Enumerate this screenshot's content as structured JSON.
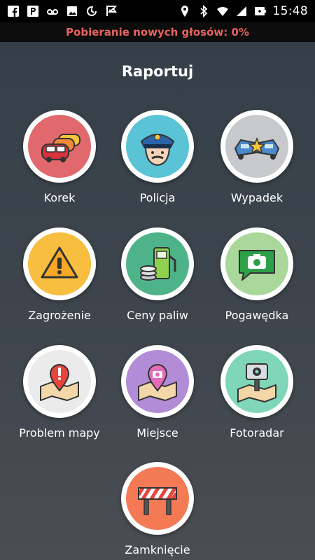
{
  "status_bar": {
    "time": "15:48",
    "left_icons": [
      "facebook-icon",
      "parking-icon",
      "voicemail-icon",
      "image-icon",
      "sync-icon",
      "check-flag-icon"
    ],
    "right_icons": [
      "location-icon",
      "bluetooth-icon",
      "wifi-icon",
      "signal-icon",
      "battery-icon"
    ]
  },
  "banner": {
    "text": "Pobieranie nowych głosów: 0%",
    "color": "#e8625f"
  },
  "title": "Raportuj",
  "tiles": [
    {
      "label": "Korek",
      "icon": "traffic-jam-icon",
      "color": "#e1696e"
    },
    {
      "label": "Policja",
      "icon": "police-icon",
      "color": "#5ac3d6"
    },
    {
      "label": "Wypadek",
      "icon": "accident-icon",
      "color": "#c7c9cc"
    },
    {
      "label": "Zagrożenie",
      "icon": "hazard-icon",
      "color": "#f7be3f"
    },
    {
      "label": "Ceny paliw",
      "icon": "fuel-price-icon",
      "color": "#4fb38a"
    },
    {
      "label": "Pogawędka",
      "icon": "chat-camera-icon",
      "color": "#a9d89a"
    },
    {
      "label": "Problem mapy",
      "icon": "map-problem-icon",
      "color": "#ebebeb"
    },
    {
      "label": "Miejsce",
      "icon": "place-icon",
      "color": "#b28cd6"
    },
    {
      "label": "Fotoradar",
      "icon": "speed-camera-icon",
      "color": "#7fd6b9"
    },
    {
      "label": "Zamknięcie",
      "icon": "road-closure-icon",
      "color": "#f47a56"
    }
  ]
}
